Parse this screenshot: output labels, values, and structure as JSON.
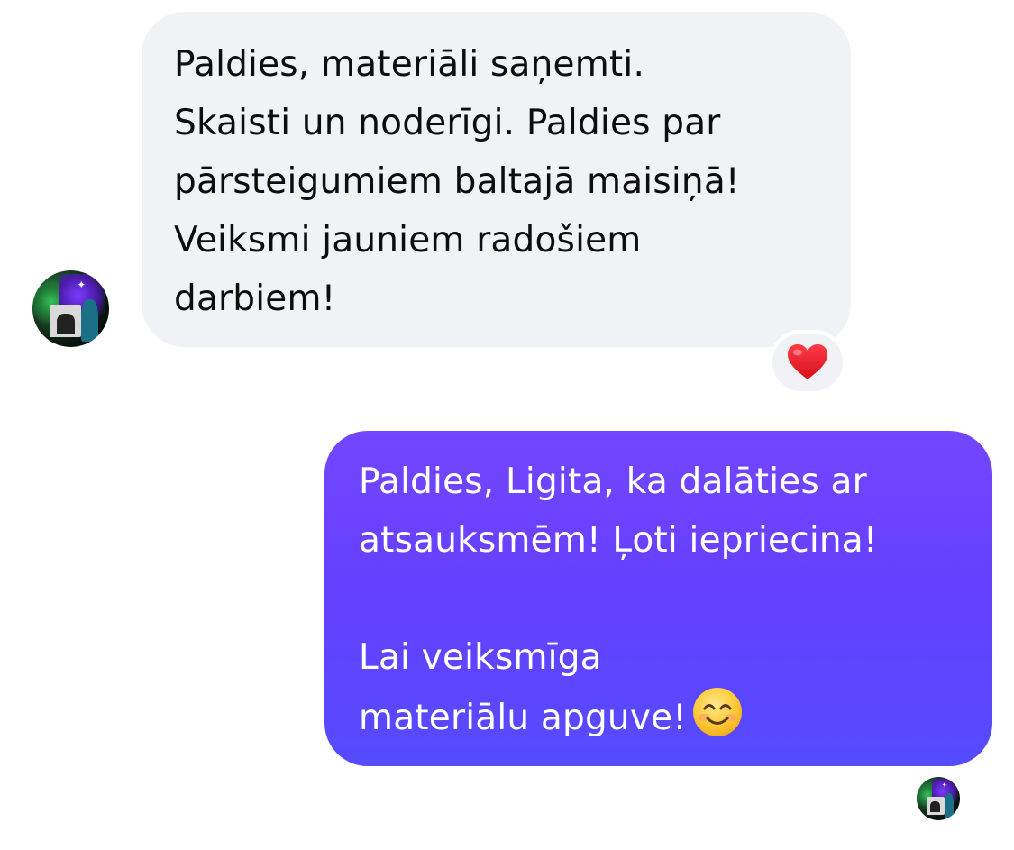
{
  "incoming": {
    "lines": [
      "Paldies, materiāli saņemti.",
      "Skaisti un noderīgi. Paldies par",
      "pārsteigumiem baltajā maisiņā!",
      "Veiksmi jauniem radošiem",
      "darbiem!"
    ],
    "reaction": "heart-icon"
  },
  "outgoing": {
    "lines": [
      "Paldies, Ligita, ka dalāties ar",
      "atsauksmēm! Ļoti iepriecina!",
      "",
      "Lai veiksmīga",
      "materiālu apguve!"
    ],
    "trailing_emoji": "smiling-face-icon"
  },
  "colors": {
    "incoming_bubble": "#f1f2f6",
    "outgoing_bubble_top": "#7346ff",
    "outgoing_bubble_bottom": "#554bff",
    "heart": "#e0202c"
  }
}
